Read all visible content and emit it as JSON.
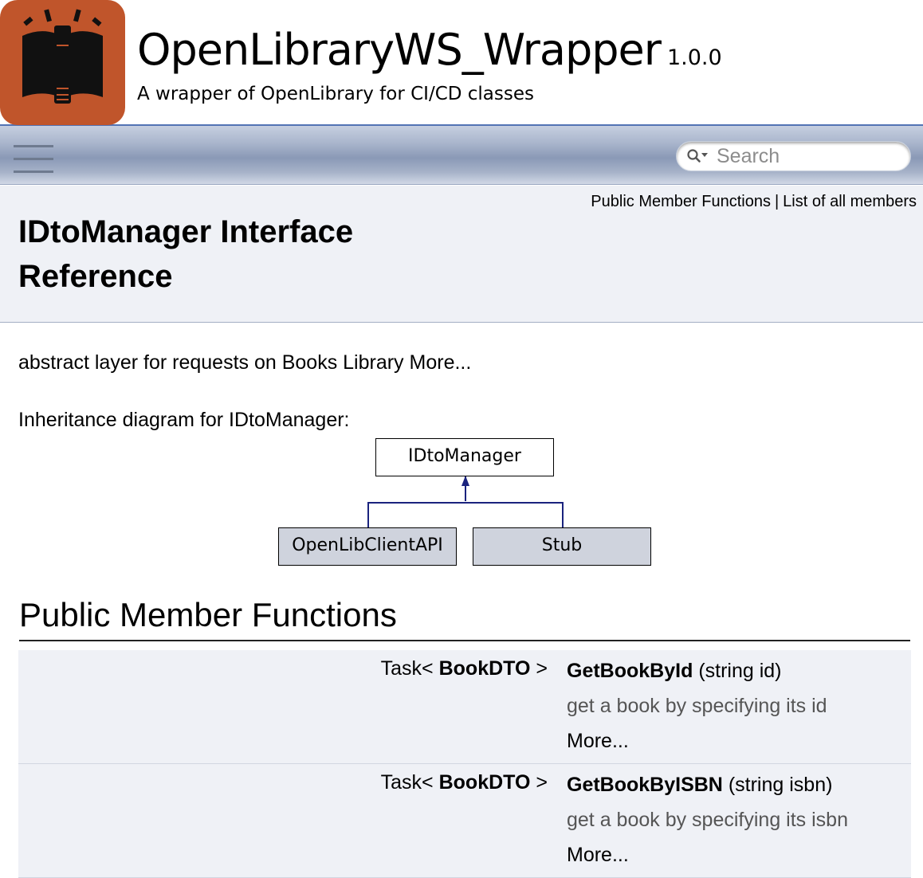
{
  "project": {
    "name": "OpenLibraryWS_Wrapper",
    "number": "1.0.0",
    "brief": "A wrapper of OpenLibrary for CI/CD classes",
    "logo_color": "#c0552b"
  },
  "search": {
    "placeholder": "Search"
  },
  "header": {
    "summary_links": [
      "Public Member Functions",
      "List of all members"
    ],
    "separator": "|",
    "title": "IDtoManager Interface Reference"
  },
  "description": {
    "brief": "abstract layer for requests on Books Library",
    "more_link": "More..."
  },
  "inheritance": {
    "label": "Inheritance diagram for IDtoManager:",
    "base": "IDtoManager",
    "derived": [
      "OpenLibClientAPI",
      "Stub"
    ]
  },
  "public_member_functions": {
    "heading": "Public Member Functions",
    "rows": [
      {
        "return_prefix": "Task<",
        "return_type": "BookDTO",
        "return_suffix": ">",
        "name": "GetBookById",
        "params": "(string id)",
        "desc": "get a book by specifying its id",
        "more": "More..."
      },
      {
        "return_prefix": "Task<",
        "return_type": "BookDTO",
        "return_suffix": ">",
        "name": "GetBookByISBN",
        "params": "(string isbn)",
        "desc": "get a book by specifying its isbn",
        "more": "More..."
      }
    ]
  },
  "colors": {
    "accent": "#5373B4",
    "header_bg": "#eff1f6",
    "diagram_line": "#1a237e",
    "derived_node_bg": "#cfd3dd"
  }
}
